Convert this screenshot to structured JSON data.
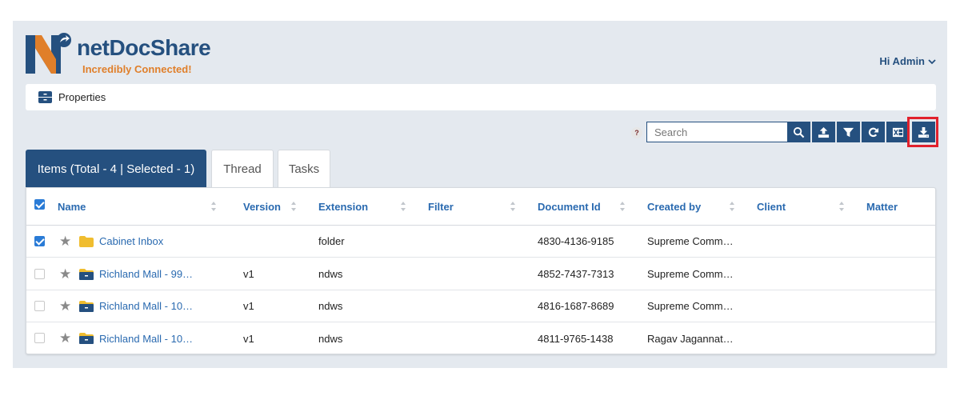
{
  "brand": {
    "name": "netDocShare",
    "tagline": "Incredibly Connected!",
    "colors": {
      "primary": "#25507f",
      "accent": "#e07f2a",
      "highlight": "#e1212d",
      "link": "#2a6ab0"
    }
  },
  "header": {
    "user_greeting": "Hi Admin"
  },
  "breadcrumb": {
    "label": "Properties"
  },
  "toolbar": {
    "help_label": "?",
    "search_placeholder": "Search",
    "buttons": [
      "search-icon",
      "upload-icon",
      "filter-icon",
      "refresh-icon",
      "excel-export-icon",
      "download-icon"
    ]
  },
  "tabs": [
    {
      "label": "Items (Total - 4 | Selected - 1)",
      "active": true
    },
    {
      "label": "Thread",
      "active": false
    },
    {
      "label": "Tasks",
      "active": false
    }
  ],
  "table": {
    "columns": [
      "Name",
      "Version",
      "Extension",
      "Filter",
      "Document Id",
      "Created by",
      "Client",
      "Matter"
    ],
    "header_checked": true,
    "rows": [
      {
        "checked": true,
        "icon": "folder-icon",
        "name": "Cabinet Inbox",
        "version": "",
        "extension": "folder",
        "filter": "",
        "document_id": "4830-4136-9185",
        "created_by": "Supreme Comm…",
        "client": "",
        "matter": ""
      },
      {
        "checked": false,
        "icon": "workspace-folder-icon",
        "name": "Richland Mall - 99…",
        "version": "v1",
        "extension": "ndws",
        "filter": "",
        "document_id": "4852-7437-7313",
        "created_by": "Supreme Comm…",
        "client": "",
        "matter": ""
      },
      {
        "checked": false,
        "icon": "workspace-folder-icon",
        "name": "Richland Mall - 10…",
        "version": "v1",
        "extension": "ndws",
        "filter": "",
        "document_id": "4816-1687-8689",
        "created_by": "Supreme Comm…",
        "client": "",
        "matter": ""
      },
      {
        "checked": false,
        "icon": "workspace-folder-icon",
        "name": "Richland Mall - 10…",
        "version": "v1",
        "extension": "ndws",
        "filter": "",
        "document_id": "4811-9765-1438",
        "created_by": "Ragav Jagannat…",
        "client": "",
        "matter": ""
      }
    ]
  }
}
